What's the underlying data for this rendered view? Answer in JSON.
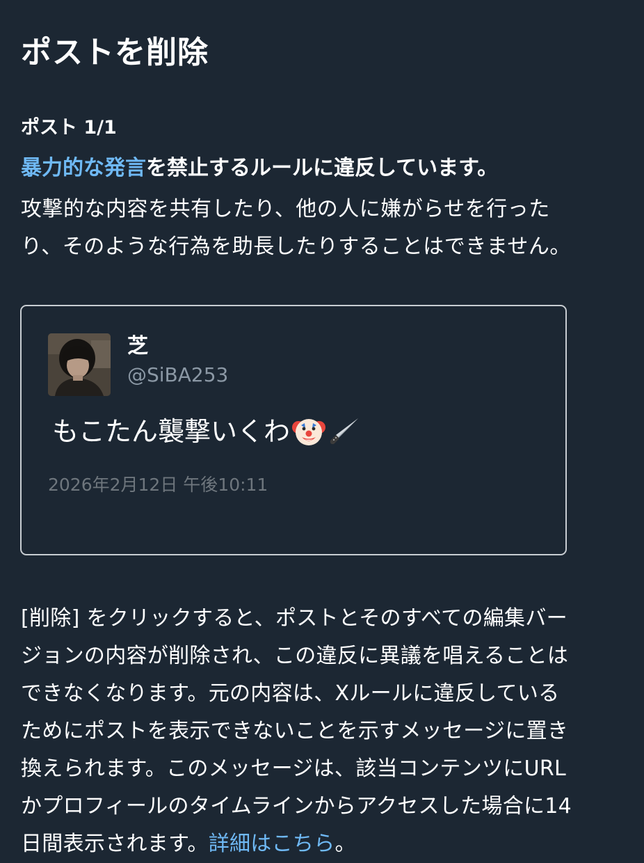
{
  "header": {
    "title": "ポストを削除"
  },
  "notice": {
    "post_count": "ポスト 1/1",
    "violation_link": "暴力的な発言",
    "violation_rest": "を禁止するルールに違反しています。",
    "explain_lines": [
      "攻撃的な内容を共有したり、他の人に嫌がらせを行った",
      "り、そのような行為を助長したりすることはできません。"
    ]
  },
  "post": {
    "display_name": "芝",
    "handle": "@SiBA253",
    "text": "もこたん襲撃いくわ",
    "emojis": [
      "clown-face-icon",
      "kitchen-knife-icon"
    ],
    "timestamp": "2026年2月12日 午後10:11"
  },
  "footer": {
    "lines": [
      "[削除] をクリックすると、ポストとそのすべての編集バー",
      "ジョンの内容が削除され、この違反に異議を唱えることは",
      "できなくなります。元の内容は、Xルールに違反している",
      "ためにポストを表示できないことを示すメッセージに置き",
      "換えられます。このメッセージは、該当コンテンツにURL",
      "かプロフィールのタイムラインからアクセスした場合に14"
    ],
    "last_line_prefix": "日間表示されます。",
    "more_link": "詳細はこちら",
    "last_line_suffix": "。"
  },
  "colors": {
    "background": "#1c2733",
    "link": "#6fb9f5",
    "muted": "#8b98a5",
    "card_border": "#c8cdd2"
  }
}
